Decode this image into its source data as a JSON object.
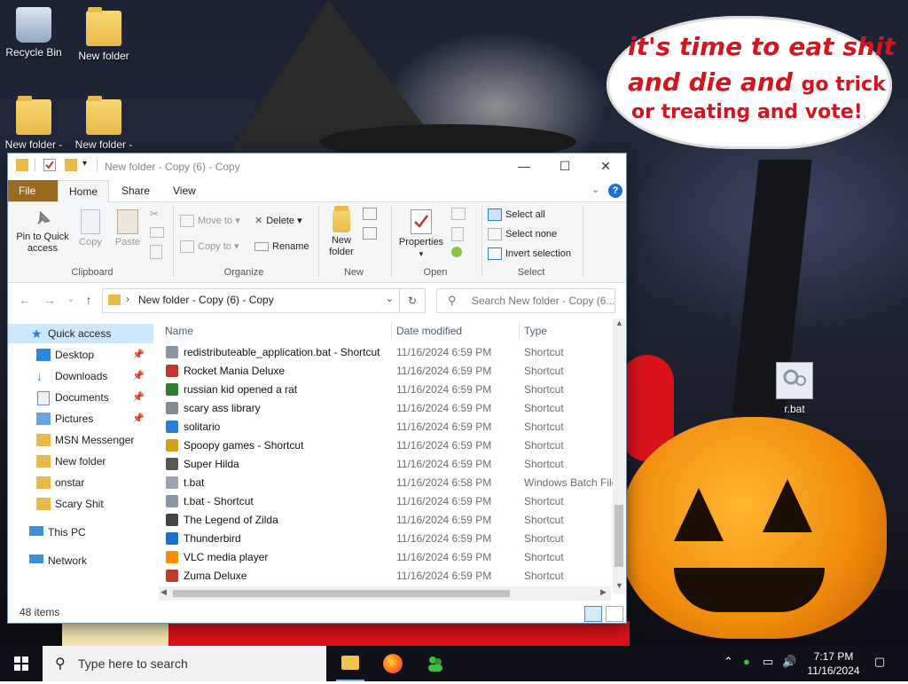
{
  "desktop": {
    "meme_text": {
      "line1": "it's time to eat shit",
      "line2a": "and die and",
      "line2b": "go trick",
      "line3": "or treating and vote!"
    },
    "icons": [
      {
        "label": "Recycle Bin",
        "icon": "recycle-bin-icon"
      },
      {
        "label": "New folder",
        "icon": "folder-icon"
      },
      {
        "label": "New folder -",
        "icon": "folder-icon"
      },
      {
        "label": "New folder -",
        "icon": "folder-icon"
      },
      {
        "label": "r.bat",
        "icon": "batch-file-icon"
      }
    ]
  },
  "window": {
    "title": "New folder - Copy (6) - Copy",
    "tabs": {
      "file": "File",
      "home": "Home",
      "share": "Share",
      "view": "View"
    },
    "ribbon": {
      "pin_line1": "Pin to Quick",
      "pin_line2": "access",
      "copy": "Copy",
      "paste": "Paste",
      "clipboard_group": "Clipboard",
      "move_to": "Move to",
      "copy_to": "Copy to",
      "delete": "Delete",
      "rename": "Rename",
      "organize_group": "Organize",
      "new_folder_line1": "New",
      "new_folder_line2": "folder",
      "new_group": "New",
      "properties": "Properties",
      "open_group": "Open",
      "select_all": "Select all",
      "select_none": "Select none",
      "invert_selection": "Invert selection",
      "select_group": "Select"
    },
    "address": {
      "path": "New folder - Copy (6) - Copy",
      "search_placeholder": "Search New folder - Copy (6..."
    },
    "nav": [
      {
        "label": "Quick access",
        "icon": "star-icon",
        "selected": true
      },
      {
        "label": "Desktop",
        "icon": "desktop-icon",
        "pinned": true
      },
      {
        "label": "Downloads",
        "icon": "download-icon",
        "pinned": true
      },
      {
        "label": "Documents",
        "icon": "document-icon",
        "pinned": true
      },
      {
        "label": "Pictures",
        "icon": "pictures-icon",
        "pinned": true
      },
      {
        "label": "MSN Messenger",
        "icon": "folder-icon"
      },
      {
        "label": "New folder",
        "icon": "folder-icon"
      },
      {
        "label": "onstar",
        "icon": "folder-icon"
      },
      {
        "label": "Scary Shit",
        "icon": "folder-icon"
      },
      {
        "label": "This PC",
        "icon": "computer-icon"
      },
      {
        "label": "Network",
        "icon": "network-icon"
      }
    ],
    "columns": {
      "name": "Name",
      "date": "Date modified",
      "type": "Type"
    },
    "files": [
      {
        "name": "redistributeable_application.bat - Shortcut",
        "date": "11/16/2024 6:59 PM",
        "type": "Shortcut"
      },
      {
        "name": "Rocket Mania Deluxe",
        "date": "11/16/2024 6:59 PM",
        "type": "Shortcut"
      },
      {
        "name": "russian kid opened a rat",
        "date": "11/16/2024 6:59 PM",
        "type": "Shortcut"
      },
      {
        "name": "scary ass library",
        "date": "11/16/2024 6:59 PM",
        "type": "Shortcut"
      },
      {
        "name": "solitario",
        "date": "11/16/2024 6:59 PM",
        "type": "Shortcut"
      },
      {
        "name": "Spoopy games - Shortcut",
        "date": "11/16/2024 6:59 PM",
        "type": "Shortcut"
      },
      {
        "name": "Super Hilda",
        "date": "11/16/2024 6:59 PM",
        "type": "Shortcut"
      },
      {
        "name": "t.bat",
        "date": "11/16/2024 6:58 PM",
        "type": "Windows Batch File"
      },
      {
        "name": "t.bat - Shortcut",
        "date": "11/16/2024 6:59 PM",
        "type": "Shortcut"
      },
      {
        "name": "The Legend of Zilda",
        "date": "11/16/2024 6:59 PM",
        "type": "Shortcut"
      },
      {
        "name": "Thunderbird",
        "date": "11/16/2024 6:59 PM",
        "type": "Shortcut"
      },
      {
        "name": "VLC media player",
        "date": "11/16/2024 6:59 PM",
        "type": "Shortcut"
      },
      {
        "name": "Zuma Deluxe",
        "date": "11/16/2024 6:59 PM",
        "type": "Shortcut"
      }
    ],
    "status": "48 items"
  },
  "taskbar": {
    "search_placeholder": "Type here to search",
    "apps": [
      "file-explorer-icon",
      "firefox-icon",
      "msn-messenger-icon"
    ],
    "time": "7:17 PM",
    "date": "11/16/2024"
  },
  "colors": {
    "accent": "#0078d7",
    "selection": "#cce8ff",
    "meme_red": "#d4141e",
    "file_tab": "#9a6b1e"
  }
}
